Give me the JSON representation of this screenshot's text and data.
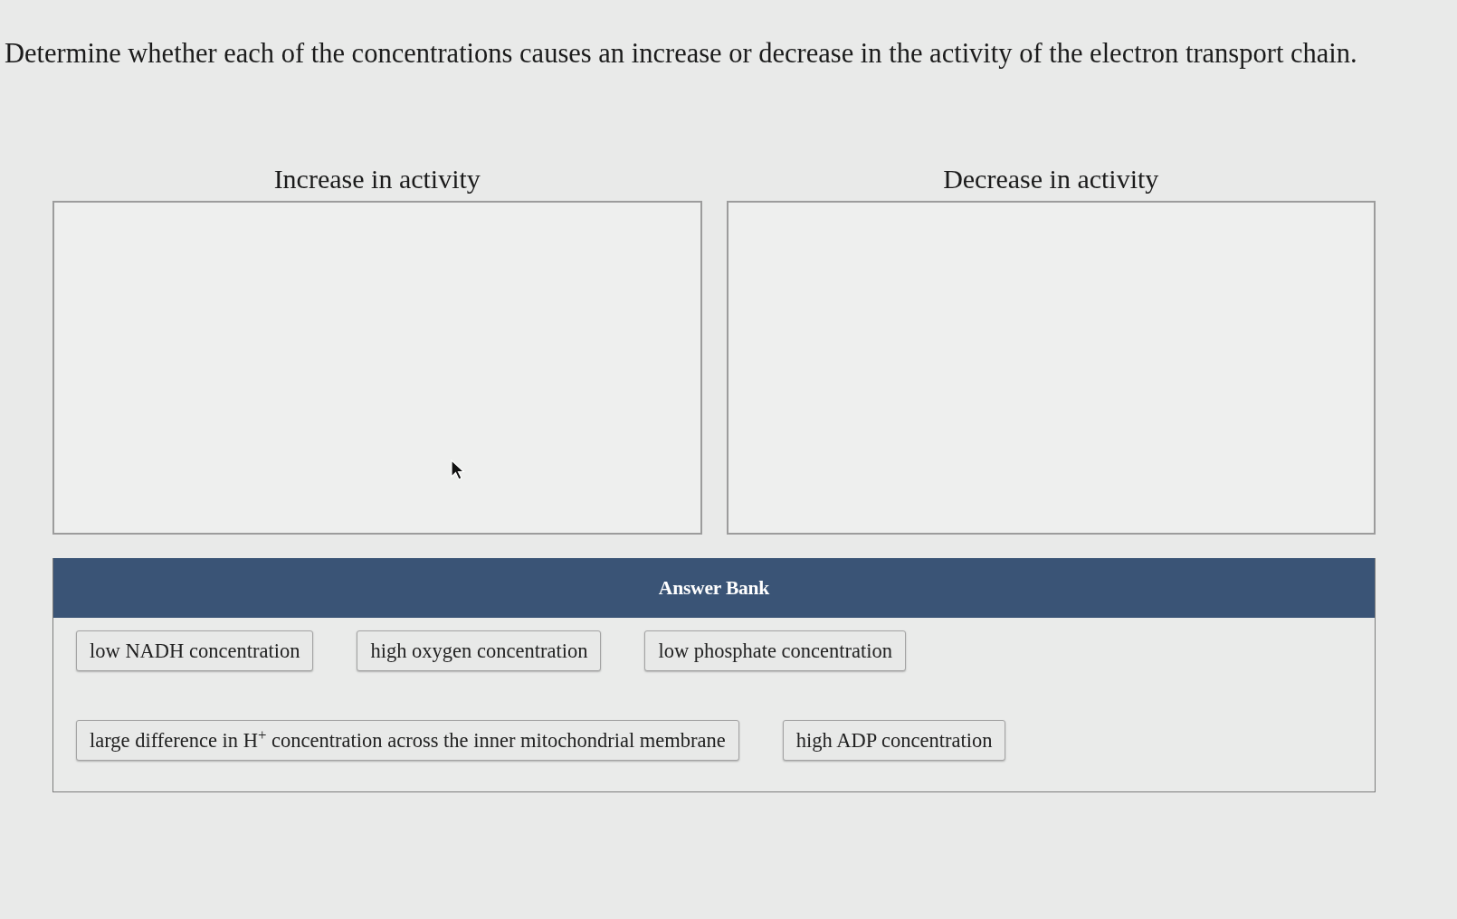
{
  "prompt": "Determine whether each of the concentrations causes an increase or decrease in the activity of the electron transport chain.",
  "bins": [
    {
      "heading": "Increase in activity"
    },
    {
      "heading": "Decrease in activity"
    }
  ],
  "answer_bank": {
    "title": "Answer Bank",
    "items": [
      "low NADH concentration",
      "high oxygen concentration",
      "low phosphate concentration",
      "large difference in H$^{+}$ concentration across the inner mitochondrial membrane",
      "high ADP concentration"
    ]
  }
}
